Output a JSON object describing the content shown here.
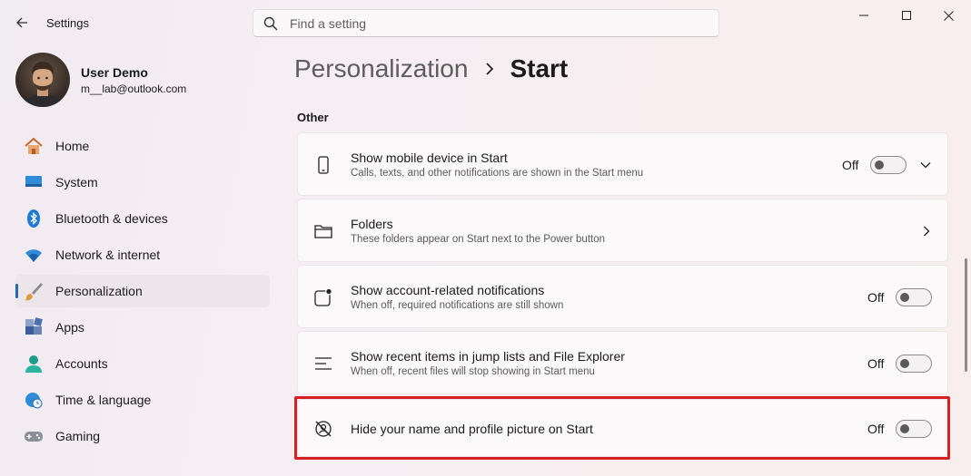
{
  "window": {
    "title": "Settings",
    "controls": [
      "minimize-icon",
      "maximize-icon",
      "close-icon"
    ]
  },
  "search": {
    "placeholder": "Find a setting"
  },
  "profile": {
    "name": "User Demo",
    "email": "m__lab@outlook.com"
  },
  "sidebar": {
    "items": [
      {
        "label": "Home",
        "icon": "home-icon"
      },
      {
        "label": "System",
        "icon": "monitor-icon"
      },
      {
        "label": "Bluetooth & devices",
        "icon": "bluetooth-icon"
      },
      {
        "label": "Network & internet",
        "icon": "wifi-icon"
      },
      {
        "label": "Personalization",
        "icon": "brush-icon",
        "active": true
      },
      {
        "label": "Apps",
        "icon": "apps-icon"
      },
      {
        "label": "Accounts",
        "icon": "person-icon"
      },
      {
        "label": "Time & language",
        "icon": "globe-clock-icon"
      },
      {
        "label": "Gaming",
        "icon": "gamepad-icon"
      }
    ]
  },
  "breadcrumb": {
    "parent": "Personalization",
    "separator": ">",
    "current": "Start"
  },
  "section": {
    "title": "Other"
  },
  "settings": [
    {
      "title": "Show mobile device in Start",
      "description": "Calls, texts, and other notifications are shown in the Start menu",
      "state": "Off",
      "icon": "phone-icon",
      "chevron": "chevron-down-icon"
    },
    {
      "title": "Folders",
      "description": "These folders appear on Start next to the Power button",
      "icon": "folder-icon",
      "chevron": "chevron-right-icon"
    },
    {
      "title": "Show account-related notifications",
      "description": "When off, required notifications are still shown",
      "state": "Off",
      "icon": "notification-badge-icon"
    },
    {
      "title": "Show recent items in jump lists and File Explorer",
      "description": "When off, recent files will stop showing in Start menu",
      "state": "Off",
      "icon": "list-icon"
    },
    {
      "title": "Hide your name and profile picture on Start",
      "state": "Off",
      "icon": "hidden-profile-icon",
      "highlighted": true
    }
  ],
  "colors": {
    "accent": "#2a66b8",
    "highlight_border": "#d81f26"
  }
}
